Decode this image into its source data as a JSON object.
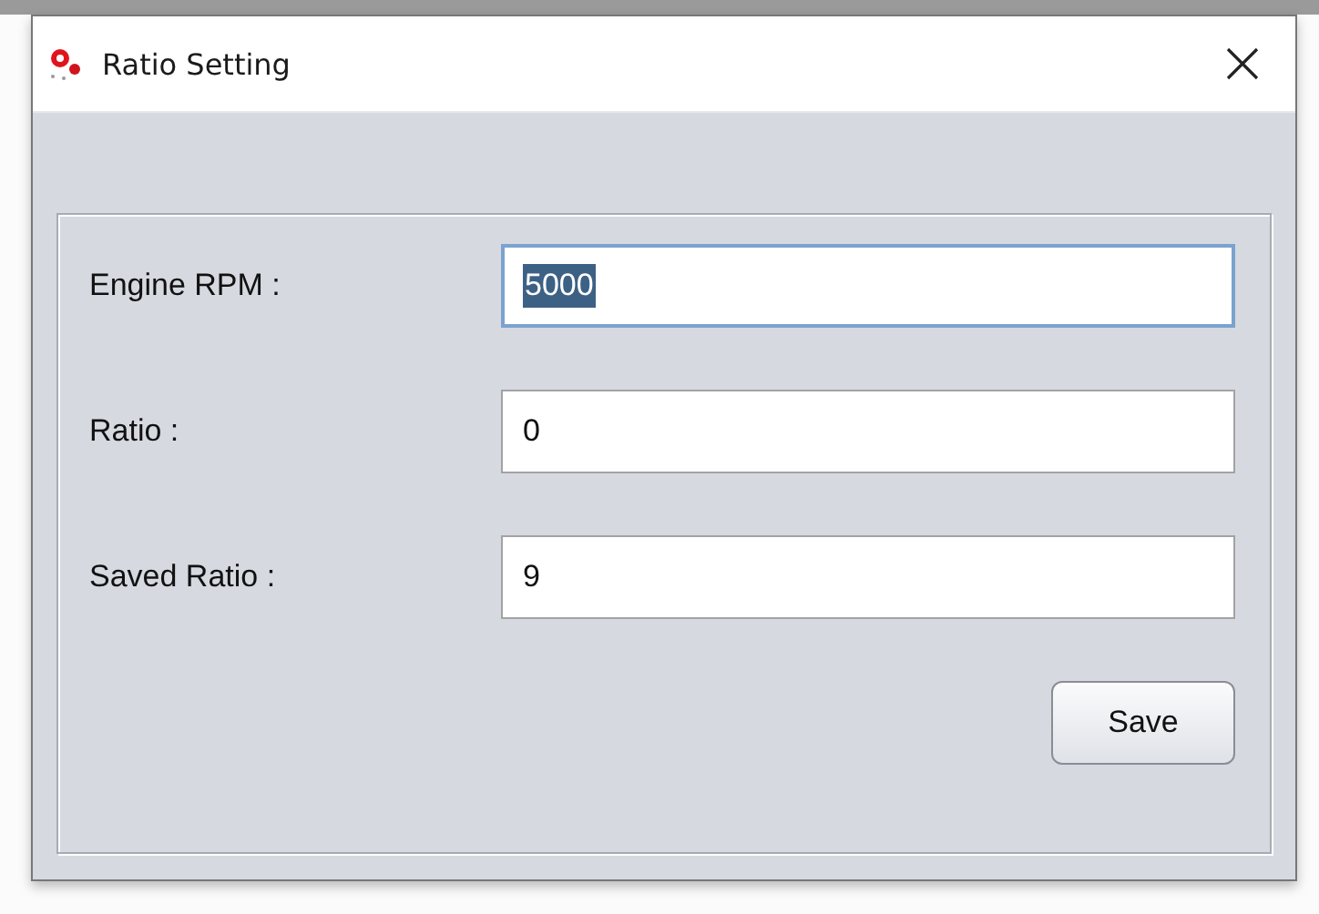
{
  "window": {
    "title": "Ratio Setting"
  },
  "fields": [
    {
      "label": "Engine RPM :",
      "value": "5000",
      "focused": true
    },
    {
      "label": "Ratio :",
      "value": "0",
      "focused": false
    },
    {
      "label": "Saved Ratio :",
      "value": "9",
      "focused": false
    }
  ],
  "buttons": [
    "Save"
  ]
}
